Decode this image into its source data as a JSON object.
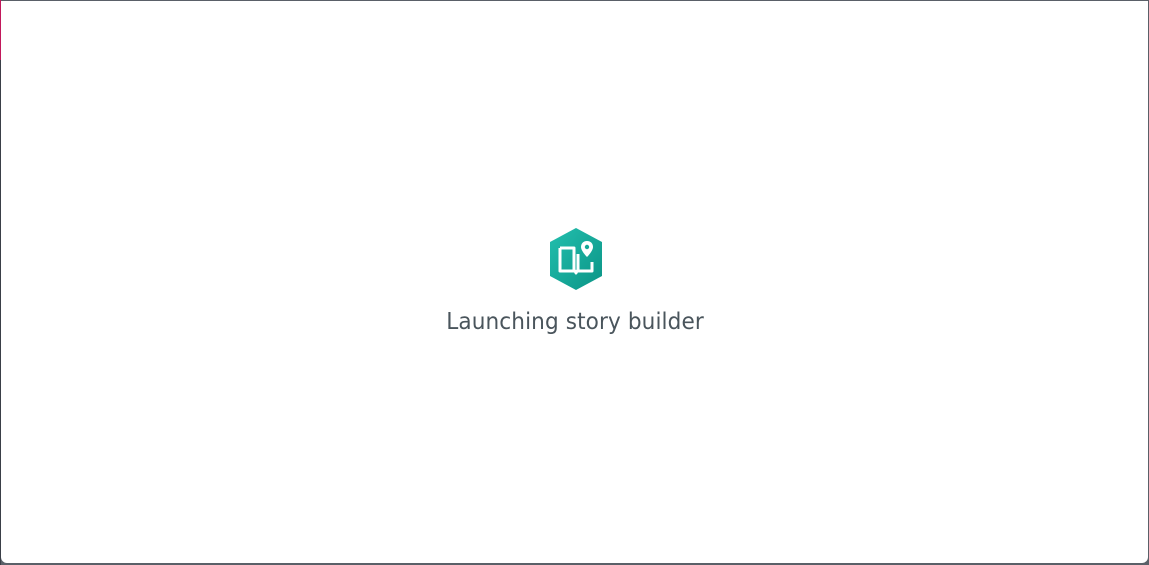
{
  "loader": {
    "icon": "storymaps-book-map-pin-icon",
    "message": "Launching story builder"
  },
  "colors": {
    "logo_light": "#1fb8a6",
    "logo_dark": "#0f9a8c",
    "text": "#4a555c",
    "background": "#ffffff"
  }
}
